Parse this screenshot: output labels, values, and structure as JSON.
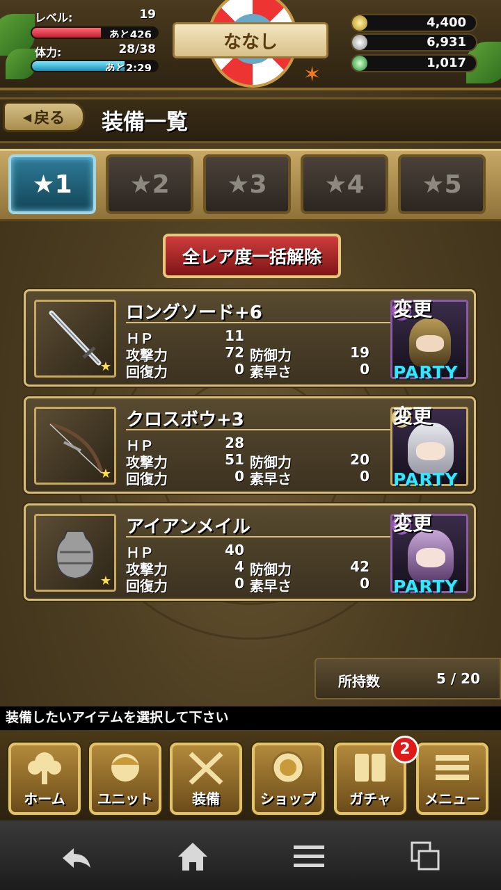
{
  "status": {
    "level_label": "レベル:",
    "level_value": "19",
    "exp_remaining": "あと426",
    "exp_progress": 0.55,
    "stamina_label": "体力:",
    "stamina_value": "28/38",
    "stamina_remaining": "あと2:29",
    "stamina_progress": 0.74,
    "player_name": "ななし",
    "currencies": [
      {
        "icon": "gold-coin-icon",
        "value": "4,400",
        "color": "#d7b640"
      },
      {
        "icon": "silver-coin-icon",
        "value": "6,931",
        "color": "#d8d8d8"
      },
      {
        "icon": "green-gem-icon",
        "value": "1,017",
        "color": "#4fd05a"
      }
    ]
  },
  "header": {
    "back_label": "戻る",
    "title": "装備一覧"
  },
  "rarity_tabs": [
    {
      "label": "★1",
      "active": true
    },
    {
      "label": "★2",
      "active": false
    },
    {
      "label": "★3",
      "active": false
    },
    {
      "label": "★4",
      "active": false
    },
    {
      "label": "★5",
      "active": false
    }
  ],
  "release_button": "全レア度一括解除",
  "stat_labels": {
    "hp": "ＨＰ",
    "atk": "攻撃力",
    "def": "防御力",
    "rec": "回復力",
    "spd": "素早さ"
  },
  "items": [
    {
      "name": "ロングソード+6",
      "icon": "long-sword-icon",
      "hp": "11",
      "atk": "72",
      "def": "19",
      "rec": "0",
      "spd": "0",
      "change_label": "変更",
      "party_label": "PARTY"
    },
    {
      "name": "クロスボウ+3",
      "icon": "crossbow-icon",
      "hp": "28",
      "atk": "51",
      "def": "20",
      "rec": "0",
      "spd": "0",
      "change_label": "変更",
      "party_label": "PARTY"
    },
    {
      "name": "アイアンメイル",
      "icon": "iron-mail-icon",
      "hp": "40",
      "atk": "4",
      "def": "42",
      "rec": "0",
      "spd": "0",
      "change_label": "変更",
      "party_label": "PARTY"
    }
  ],
  "possession": {
    "label": "所持数",
    "value": "5 / 20"
  },
  "hint": "装備したいアイテムを選択して下さい",
  "nav": [
    {
      "label": "ホーム",
      "icon": "home-tree-icon"
    },
    {
      "label": "ユニット",
      "icon": "unit-face-icon"
    },
    {
      "label": "装備",
      "icon": "crossed-swords-icon"
    },
    {
      "label": "ショップ",
      "icon": "shop-coin-icon"
    },
    {
      "label": "ガチャ",
      "icon": "gacha-cards-icon"
    },
    {
      "label": "メニュー",
      "icon": "menu-list-icon"
    }
  ],
  "gacha_badge": "2"
}
